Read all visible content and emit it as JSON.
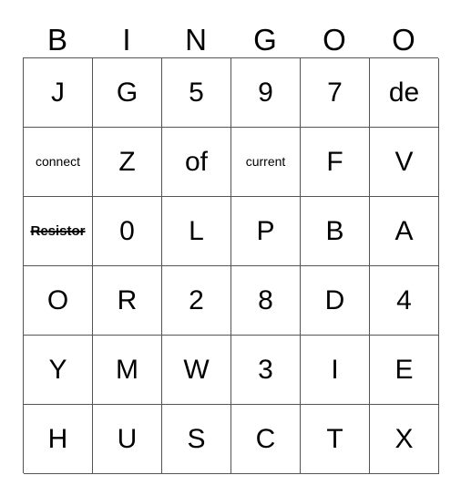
{
  "card": {
    "title": "BINGOO",
    "header": {
      "letters": [
        "B",
        "I",
        "N",
        "G",
        "O",
        "O"
      ]
    },
    "grid": {
      "columns": 6,
      "rows": 6,
      "border_color": "#555555",
      "background_color": "#ffffff",
      "text_color": "#000000",
      "cells": [
        [
          {
            "text": "J",
            "size": "large",
            "marked": false
          },
          {
            "text": "G",
            "size": "large",
            "marked": false
          },
          {
            "text": "5",
            "size": "large",
            "marked": false
          },
          {
            "text": "9",
            "size": "large",
            "marked": false
          },
          {
            "text": "7",
            "size": "large",
            "marked": false
          },
          {
            "text": "de",
            "size": "large",
            "marked": false
          }
        ],
        [
          {
            "text": "connect",
            "size": "small",
            "marked": false
          },
          {
            "text": "Z",
            "size": "large",
            "marked": false
          },
          {
            "text": "of",
            "size": "large",
            "marked": false
          },
          {
            "text": "current",
            "size": "small",
            "marked": false
          },
          {
            "text": "F",
            "size": "large",
            "marked": false
          },
          {
            "text": "V",
            "size": "large",
            "marked": false
          }
        ],
        [
          {
            "text": "Resistor",
            "size": "small",
            "marked": true
          },
          {
            "text": "0",
            "size": "large",
            "marked": false
          },
          {
            "text": "L",
            "size": "large",
            "marked": false
          },
          {
            "text": "P",
            "size": "large",
            "marked": false
          },
          {
            "text": "B",
            "size": "large",
            "marked": false
          },
          {
            "text": "A",
            "size": "large",
            "marked": false
          }
        ],
        [
          {
            "text": "O",
            "size": "large",
            "marked": false
          },
          {
            "text": "R",
            "size": "large",
            "marked": false
          },
          {
            "text": "2",
            "size": "large",
            "marked": false
          },
          {
            "text": "8",
            "size": "large",
            "marked": false
          },
          {
            "text": "D",
            "size": "large",
            "marked": false
          },
          {
            "text": "4",
            "size": "large",
            "marked": false
          }
        ],
        [
          {
            "text": "Y",
            "size": "large",
            "marked": false
          },
          {
            "text": "M",
            "size": "large",
            "marked": false
          },
          {
            "text": "W",
            "size": "large",
            "marked": false
          },
          {
            "text": "3",
            "size": "large",
            "marked": false
          },
          {
            "text": "I",
            "size": "large",
            "marked": false
          },
          {
            "text": "E",
            "size": "large",
            "marked": false
          }
        ],
        [
          {
            "text": "H",
            "size": "large",
            "marked": false
          },
          {
            "text": "U",
            "size": "large",
            "marked": false
          },
          {
            "text": "S",
            "size": "large",
            "marked": false
          },
          {
            "text": "C",
            "size": "large",
            "marked": false
          },
          {
            "text": "T",
            "size": "large",
            "marked": false
          },
          {
            "text": "X",
            "size": "large",
            "marked": false
          }
        ]
      ]
    }
  }
}
